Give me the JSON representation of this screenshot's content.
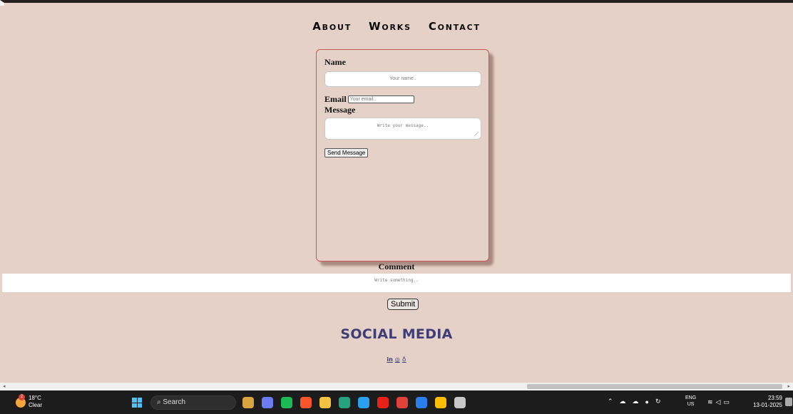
{
  "nav": {
    "about": "About",
    "works": "Works",
    "contact": "Contact"
  },
  "form": {
    "name_label": "Name",
    "name_placeholder": "Your name..",
    "email_label": "Email",
    "email_placeholder": "Your email..",
    "message_label": "Message",
    "message_placeholder": "Write your message..",
    "send_label": "Send Message"
  },
  "comment": {
    "label": "Comment",
    "placeholder": "Write something..",
    "submit_label": "Submit"
  },
  "social": {
    "title": "SOCIAL MEDIA",
    "icons": [
      "in",
      "◎",
      "♁"
    ]
  },
  "taskbar": {
    "weather_temp": "18°C",
    "weather_desc": "Clear",
    "search_label": "Search",
    "lang_top": "ENG",
    "lang_bottom": "US",
    "time": "23:59",
    "date": "13-01-2025",
    "app_icons": [
      "file-explorer-icon",
      "copilot-icon",
      "spotify-icon",
      "brave-icon",
      "folder-icon",
      "edu-icon",
      "edge-icon",
      "youtube-icon",
      "wps-icon",
      "vscode-icon",
      "chrome-icon",
      "snip-icon"
    ],
    "app_colors": [
      "#d9a441",
      "#6b7bf0",
      "#1db954",
      "#fb542b",
      "#f5c242",
      "#26a17b",
      "#2b9ff0",
      "#e62117",
      "#e0413a",
      "#2b7de9",
      "#fbbc05",
      "#c8c8c8"
    ]
  }
}
